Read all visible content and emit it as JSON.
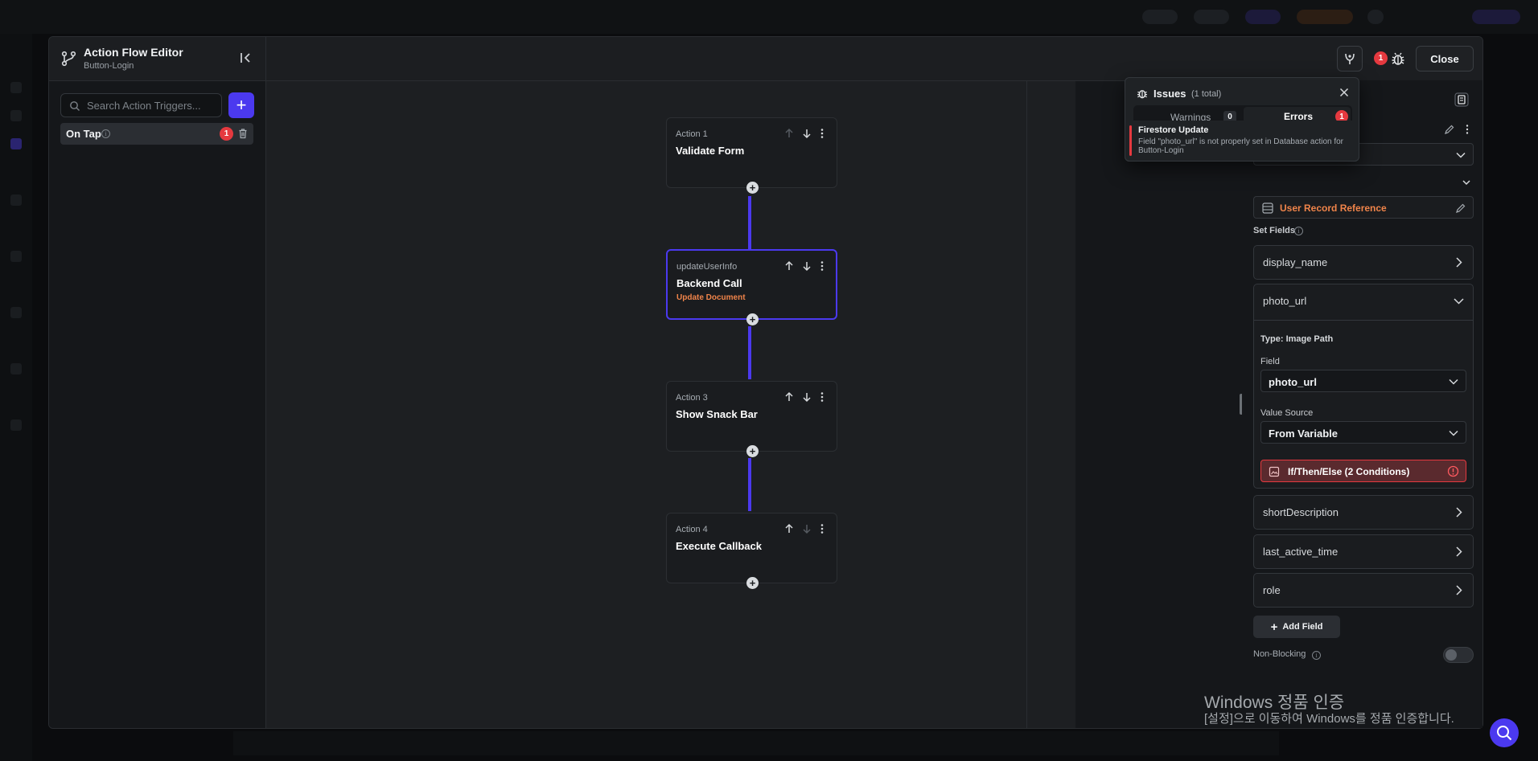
{
  "editor": {
    "title": "Action Flow Editor",
    "subtitle": "Button-Login",
    "close_label": "Close",
    "error_count": "1"
  },
  "sidebar": {
    "search_placeholder": "Search Action Triggers...",
    "add_label": "+",
    "triggers": [
      {
        "label": "On Tap",
        "error_count": "1"
      }
    ]
  },
  "flow": {
    "nodes": [
      {
        "label": "Action 1",
        "title": "Validate Form",
        "subtitle": ""
      },
      {
        "label": "updateUserInfo",
        "title": "Backend Call",
        "subtitle": "Update Document"
      },
      {
        "label": "Action 3",
        "title": "Show Snack Bar",
        "subtitle": ""
      },
      {
        "label": "Action 4",
        "title": "Execute Callback",
        "subtitle": ""
      }
    ],
    "add_symbol": "+"
  },
  "issues": {
    "title": "Issues",
    "total": "(1 total)",
    "tabs": [
      {
        "label": "Warnings",
        "count": "0"
      },
      {
        "label": "Errors",
        "count": "1"
      }
    ],
    "items": [
      {
        "title": "Firestore Update",
        "message": "Field \"photo_url\" is not properly set in Database action for Button-Login"
      }
    ]
  },
  "properties": {
    "reference_label": "User Record Reference",
    "set_fields_label": "Set Fields",
    "fields": [
      {
        "name": "display_name"
      },
      {
        "name": "photo_url"
      },
      {
        "name": "shortDescription"
      },
      {
        "name": "last_active_time"
      },
      {
        "name": "role"
      }
    ],
    "expanded": {
      "type_label": "Type: Image Path",
      "field_label": "Field",
      "field_value": "photo_url",
      "value_source_label": "Value Source",
      "value_source_value": "From Variable",
      "condition_label": "If/Then/Else (2 Conditions)"
    },
    "add_field_label": "Add Field",
    "add_field_plus": "+",
    "non_blocking_label": "Non-Blocking",
    "non_blocking_enabled": false
  },
  "windows_watermark": {
    "title": "Windows 정품 인증",
    "subtitle": "[설정]으로 이동하여 Windows를 정품 인증합니다."
  },
  "colors": {
    "accent": "#4b39ef",
    "error": "#e5393f",
    "warning_text": "#f0844a"
  }
}
